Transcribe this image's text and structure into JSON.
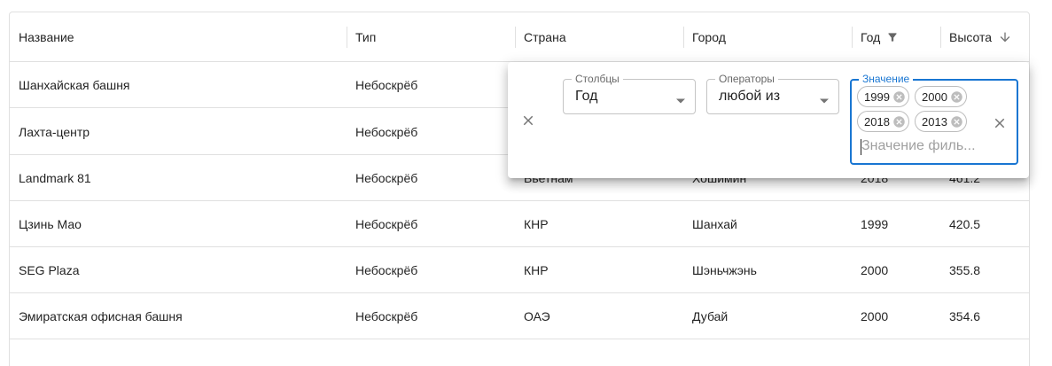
{
  "columns": {
    "name": "Название",
    "type": "Тип",
    "country": "Страна",
    "city": "Город",
    "year": "Год",
    "height": "Высота"
  },
  "rows": [
    {
      "name": "Шанхайская башня",
      "type": "Небоскрёб",
      "country": "",
      "city": "",
      "year": "",
      "height": ""
    },
    {
      "name": "Лахта-центр",
      "type": "Небоскрёб",
      "country": "",
      "city": "",
      "year": "",
      "height": ""
    },
    {
      "name": "Landmark 81",
      "type": "Небоскрёб",
      "country": "Вьетнам",
      "city": "Хошимин",
      "year": "2018",
      "height": "461.2"
    },
    {
      "name": "Цзинь Мао",
      "type": "Небоскрёб",
      "country": "КНР",
      "city": "Шанхай",
      "year": "1999",
      "height": "420.5"
    },
    {
      "name": "SEG Plaza",
      "type": "Небоскрёб",
      "country": "КНР",
      "city": "Шэньчжэнь",
      "year": "2000",
      "height": "355.8"
    },
    {
      "name": "Эмиратская офисная башня",
      "type": "Небоскрёб",
      "country": "ОАЭ",
      "city": "Дубай",
      "year": "2000",
      "height": "354.6"
    }
  ],
  "filter_panel": {
    "columns_label": "Столбцы",
    "columns_value": "Год",
    "operator_label": "Операторы",
    "operator_value": "любой из",
    "value_label": "Значение",
    "chips": [
      "1999",
      "2000",
      "2018",
      "2013"
    ],
    "value_placeholder": "Значение филь..."
  },
  "icons": {
    "filter": "filter-icon",
    "sort": "arrow-down-icon",
    "delete": "close-icon",
    "clear": "close-icon",
    "dropdown": "triangle-down-icon",
    "chip_delete": "cancel-circle-icon"
  },
  "colors": {
    "accent": "#1976d2",
    "border": "#e0e0e0"
  }
}
